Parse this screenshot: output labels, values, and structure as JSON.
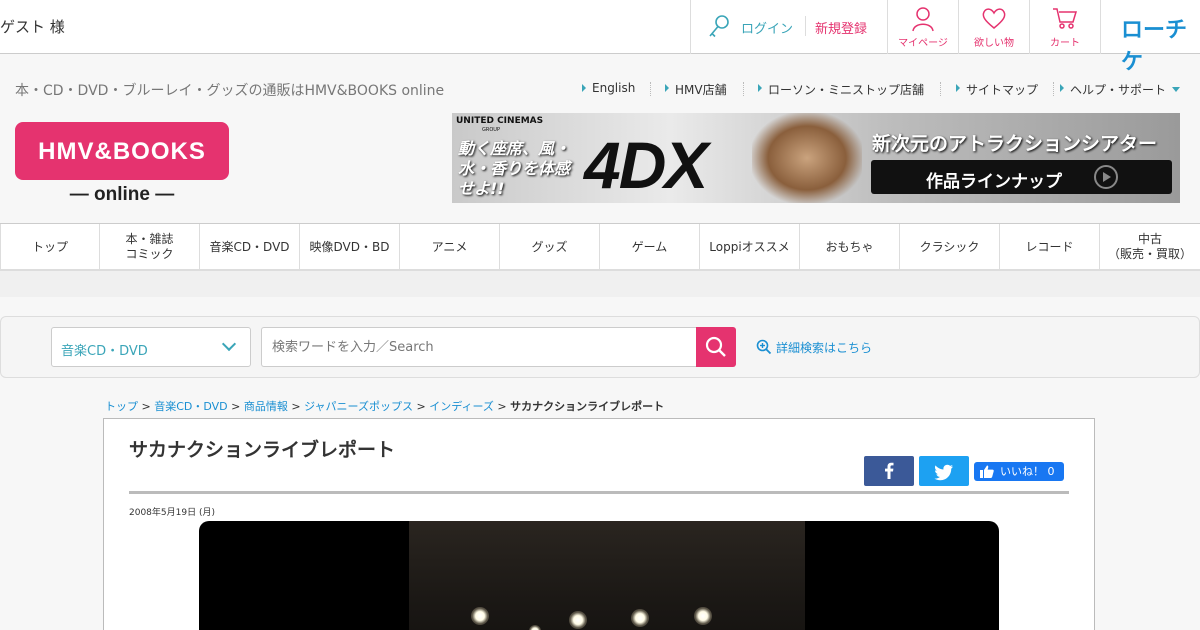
{
  "topbar": {
    "guest_label": "ゲスト 様",
    "login_label": "ログイン",
    "register_label": "新規登録",
    "mypage_label": "マイページ",
    "wishlist_label": "欲しい物",
    "cart_label": "カート",
    "ticket_label": "ローチケ"
  },
  "header": {
    "tagline": "本・CD・DVD・ブルーレイ・グッズの通販はHMV&BOOKS online",
    "links": [
      "English",
      "HMV店舗",
      "ローソン・ミニストップ店舗",
      "サイトマップ",
      "ヘルプ・サポート"
    ],
    "logo_top": "HMV&BOOKS",
    "logo_bottom": "— online —"
  },
  "banner": {
    "group": "UNITED CINEMAS",
    "group_sub": "GROUP",
    "left_copy": "動く座席、風・水・香りを体感せよ!!",
    "product": "4DX",
    "right_copy": "新次元のアトラクションシアター",
    "button_label": "作品ラインナップ"
  },
  "nav": {
    "items": [
      "トップ",
      "本・雑誌\nコミック",
      "音楽CD・DVD",
      "映像DVD・BD",
      "アニメ",
      "グッズ",
      "ゲーム",
      "Loppiオススメ",
      "おもちゃ",
      "クラシック",
      "レコード",
      "中古\n（販売・買取）"
    ]
  },
  "search": {
    "category": "音楽CD・DVD",
    "placeholder": "検索ワードを入力／Search",
    "advanced_label": "詳細検索はこちら"
  },
  "breadcrumb": {
    "links": [
      "トップ",
      "音楽CD・DVD",
      "商品情報",
      "ジャパニーズポップス",
      "インディーズ"
    ],
    "separator": ">",
    "current": "サカナクションライブレポート"
  },
  "article": {
    "title": "サカナクションライブレポート",
    "date": "2008年5月19日 (月)",
    "like_label": "いいね！ 0"
  },
  "colors": {
    "brand_pink": "#e5336f",
    "accent_teal": "#3aa5b8",
    "link_blue": "#1a8fd2",
    "facebook": "#3b5998",
    "twitter": "#1da1f2"
  }
}
